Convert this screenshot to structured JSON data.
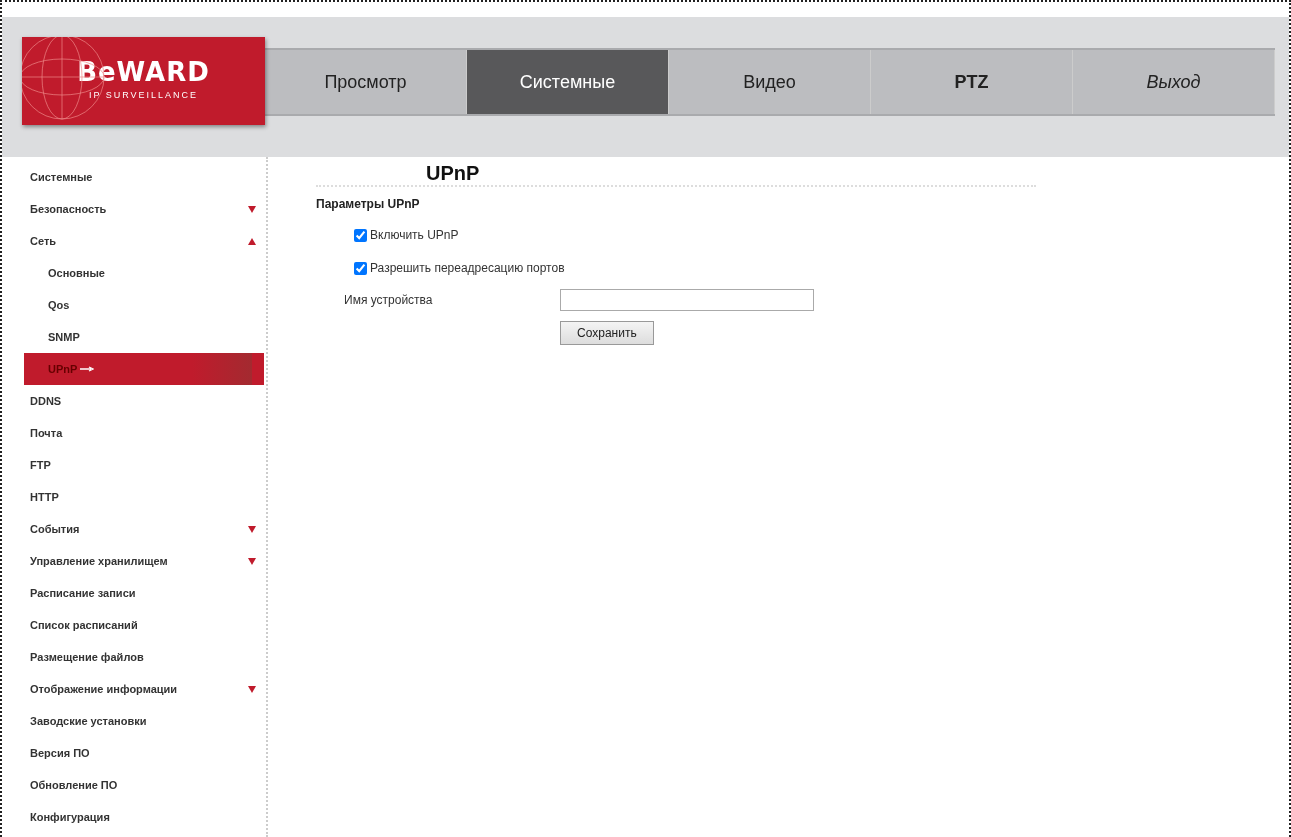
{
  "logo": {
    "brand": "BeWARD",
    "tagline": "IP SURVEILLANCE"
  },
  "tabs": [
    {
      "label": "Просмотр",
      "selected": false,
      "kind": "plain"
    },
    {
      "label": "Системные",
      "selected": true,
      "kind": "plain"
    },
    {
      "label": "Видео",
      "selected": false,
      "kind": "plain"
    },
    {
      "label": "PTZ",
      "selected": false,
      "kind": "bold"
    },
    {
      "label": "Выход",
      "selected": false,
      "kind": "italic"
    }
  ],
  "sidebar": {
    "items": [
      {
        "label": "Системные",
        "selected": false
      },
      {
        "label": "Безопасность",
        "selected": false,
        "expanded": false
      },
      {
        "label": "Сеть",
        "selected": false,
        "expanded": true,
        "children": [
          {
            "label": "Основные",
            "selected": false
          },
          {
            "label": "Qos",
            "selected": false
          },
          {
            "label": "SNMP",
            "selected": false
          },
          {
            "label": "UPnP",
            "selected": true
          }
        ]
      },
      {
        "label": "DDNS",
        "selected": false
      },
      {
        "label": "Почта",
        "selected": false
      },
      {
        "label": "FTP",
        "selected": false
      },
      {
        "label": "HTTP",
        "selected": false
      },
      {
        "label": "События",
        "selected": false,
        "expanded": false
      },
      {
        "label": "Управление хранилищем",
        "selected": false,
        "expanded": false
      },
      {
        "label": "Расписание записи",
        "selected": false
      },
      {
        "label": "Список расписаний",
        "selected": false
      },
      {
        "label": "Размещение файлов",
        "selected": false
      },
      {
        "label": "Отображение информации",
        "selected": false,
        "expanded": false
      },
      {
        "label": "Заводские установки",
        "selected": false
      },
      {
        "label": "Версия ПО",
        "selected": false
      },
      {
        "label": "Обновление ПО",
        "selected": false
      },
      {
        "label": "Конфигурация",
        "selected": false
      }
    ]
  },
  "content": {
    "title": "UPnP",
    "section": "Параметры UPnP",
    "checkboxes": [
      {
        "label": "Включить UPnP",
        "checked": true
      },
      {
        "label": "Разрешить переадресацию портов",
        "checked": true
      }
    ],
    "device_name": {
      "label": "Имя устройства"
    },
    "save_button": "Сохранить"
  }
}
